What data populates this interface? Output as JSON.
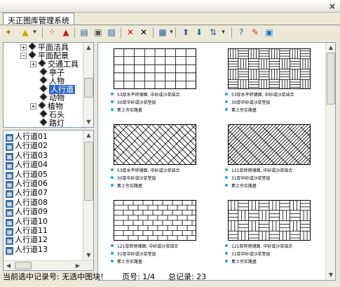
{
  "window": {
    "close_glyph": "×"
  },
  "tab": {
    "label": "天正图库管理系统"
  },
  "toolbar": [
    {
      "name": "new-lib-icon",
      "glyph": "✦",
      "color": "#b07a10"
    },
    {
      "name": "open-lib-icon",
      "glyph": "▲",
      "color": "#d6a100"
    },
    {
      "name": "open-lib-dropdown-icon",
      "glyph": "▾",
      "color": "#333"
    },
    {
      "name": "select-all-icon",
      "glyph": "⁘",
      "color": "#c00"
    },
    {
      "name": "new-category-icon",
      "glyph": "▲",
      "color": "#c82020"
    },
    {
      "name": "open-category-icon",
      "glyph": "▤",
      "color": "#2a5fa0"
    },
    {
      "name": "copy-icon",
      "glyph": "▣",
      "color": "#555"
    },
    {
      "name": "paste-icon",
      "glyph": "▨",
      "color": "#2a5fa0"
    },
    {
      "name": "delete-icon",
      "glyph": "✕",
      "color": "#d01010"
    },
    {
      "name": "cut-icon",
      "glyph": "✕",
      "color": "#000"
    },
    {
      "name": "view-mode-icon",
      "glyph": "▦",
      "color": "#2a5fa0"
    },
    {
      "name": "view-mode-dropdown-icon",
      "glyph": "▾",
      "color": "#333"
    },
    {
      "name": "move-up-icon",
      "glyph": "⬆",
      "color": "#2a5fa0"
    },
    {
      "name": "move-down-icon",
      "glyph": "⬇",
      "color": "#2a5fa0"
    },
    {
      "name": "sort-icon",
      "glyph": "⇅",
      "color": "#2a5fa0"
    },
    {
      "name": "sort-dropdown-icon",
      "glyph": "▾",
      "color": "#333"
    },
    {
      "name": "help-icon",
      "glyph": "?",
      "color": "#2a5fa0"
    },
    {
      "name": "edit-icon",
      "glyph": "✎",
      "color": "#c03030"
    },
    {
      "name": "settings-icon",
      "glyph": "▣",
      "color": "#1f78c8"
    }
  ],
  "tree": [
    {
      "label": "平面洁具",
      "expander": "+",
      "level": 1
    },
    {
      "label": "平面配景",
      "expander": "−",
      "level": 1
    },
    {
      "label": "交通工具",
      "expander": "+",
      "level": 2
    },
    {
      "label": "亭子",
      "expander": "",
      "level": 2
    },
    {
      "label": "人物",
      "expander": "",
      "level": 2
    },
    {
      "label": "人行道",
      "expander": "",
      "level": 2,
      "selected": true
    },
    {
      "label": "动物",
      "expander": "",
      "level": 2
    },
    {
      "label": "植物",
      "expander": "+",
      "level": 2
    },
    {
      "label": "石头",
      "expander": "",
      "level": 2
    },
    {
      "label": "路灯",
      "expander": "",
      "level": 2
    }
  ],
  "list": [
    "人行道01",
    "人行道02",
    "人行道03",
    "人行道04",
    "人行道05",
    "人行道06",
    "人行道07",
    "人行道08",
    "人行道09",
    "人行道10",
    "人行道11",
    "人行道12",
    "人行道13"
  ],
  "cells": [
    {
      "pattern": "grid",
      "captions": [
        "53厚水平砖铺面, 中砂或沙浆结合",
        "30厚中砂或沙浆垫层",
        "素土夯实路基"
      ]
    },
    {
      "pattern": "basket",
      "captions": [
        "53厚水平砖铺面, 中砂或沙浆结合",
        "30厚中砂或沙浆垫层",
        "素土夯实路基"
      ]
    },
    {
      "pattern": "herringbone",
      "captions": [
        "53厚水平砖铺面, 中砂或沙浆结合",
        "30厚中砂或沙浆垫层",
        "素土夯实路基"
      ]
    },
    {
      "pattern": "herringbone2",
      "captions": [
        "121厚砖侧铺面, 中砂或沙浆结合",
        "31厚中砂或沙浆垫层",
        "素土夯实路基"
      ]
    },
    {
      "pattern": "running",
      "captions": [
        "121厚砖侧铺面, 中砂或沙浆结合",
        "31厚中砂或沙浆垫层",
        "素土夯实路基"
      ]
    },
    {
      "pattern": "weave",
      "captions": [
        "121厚砖侧铺面, 中砂或沙浆结合",
        "31厚中砂或沙浆垫层",
        "素土夯实路基"
      ]
    }
  ],
  "status": {
    "current": "当前选中记录号: 无选中图块!",
    "page": "页号: 1/4",
    "total": "总记录:  23"
  }
}
